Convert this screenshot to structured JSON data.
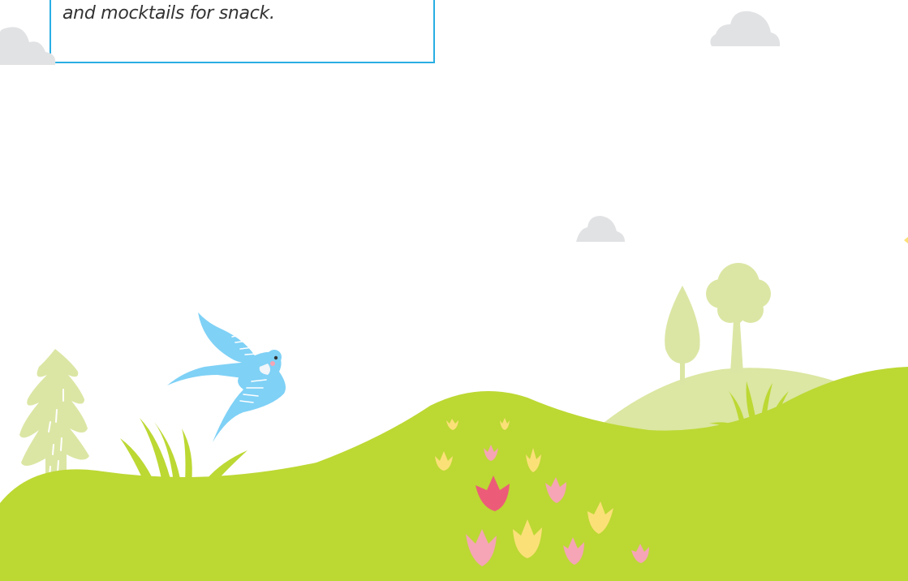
{
  "caption": {
    "text": "and mocktails for snack."
  },
  "colors": {
    "caption_border": "#29aee3",
    "caption_text": "#333333",
    "hill_front": "#bcd833",
    "hill_back": "#dbe7a2",
    "tree_light": "#dbe6a4",
    "cloud": "#e1e2e4",
    "bird": "#7fd1f6",
    "tulip_yellow": "#fbe078",
    "tulip_pink": "#f5a5b5",
    "tulip_red": "#ec5c78"
  },
  "icons": [
    "cloud-icon",
    "bird-icon",
    "pine-tree-icon",
    "round-tree-icon",
    "poplar-tree-icon",
    "grass-icon",
    "tulip-icon"
  ]
}
